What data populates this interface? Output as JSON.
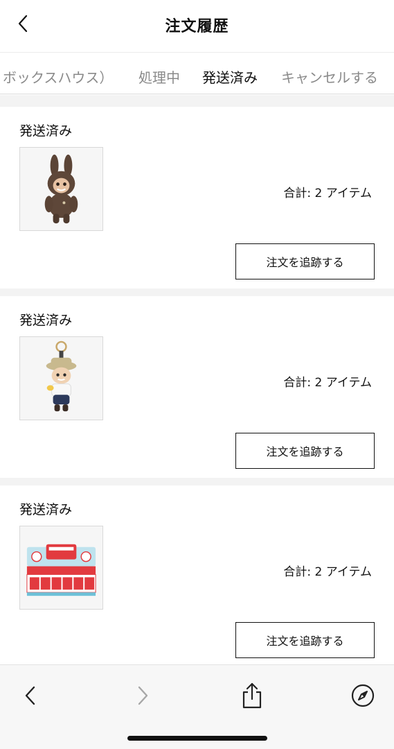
{
  "header": {
    "title": "注文履歴",
    "back_icon": "chevron-left-icon"
  },
  "tabs": [
    {
      "label": "ボックスハウス）",
      "active": false
    },
    {
      "label": "処理中",
      "active": false
    },
    {
      "label": "発送済み",
      "active": true
    },
    {
      "label": "キャンセルする",
      "active": false
    }
  ],
  "orders": [
    {
      "status": "発送済み",
      "total": "合計: 2 アイテム",
      "track_label": "注文を追跡する",
      "image": "brown-plush-doll"
    },
    {
      "status": "発送済み",
      "total": "合計: 2 アイテム",
      "track_label": "注文を追跡する",
      "image": "explorer-doll-keychain"
    },
    {
      "status": "発送済み",
      "total": "合計: 2 アイテム",
      "track_label": "注文を追跡する",
      "image": "blind-box-set"
    }
  ],
  "toolbar": {
    "back_icon": "chevron-left-icon",
    "forward_icon": "chevron-right-icon",
    "share_icon": "share-icon",
    "compass_icon": "compass-icon"
  },
  "colors": {
    "accent": "#e0262f",
    "tab_inactive": "#8a8a8a",
    "background": "#f3f3f3"
  }
}
